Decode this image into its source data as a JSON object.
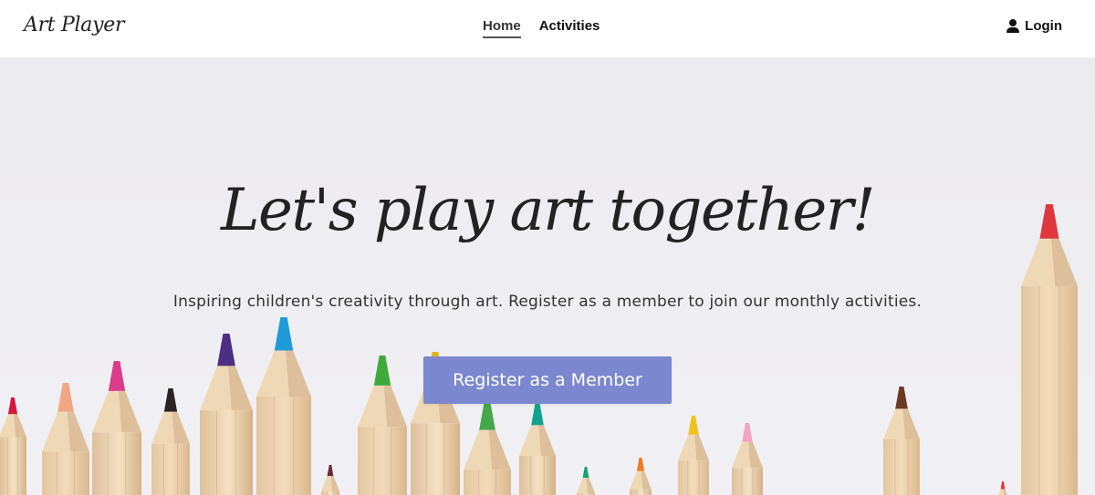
{
  "header": {
    "brand": "Art Player",
    "nav": [
      {
        "label": "Home",
        "active": true
      },
      {
        "label": "Activities",
        "active": false
      }
    ],
    "login_label": "Login",
    "login_icon": "user-icon"
  },
  "hero": {
    "title": "Let's play art together!",
    "subtitle": "Inspiring children's creativity through art. Register as a member to join our monthly activities.",
    "cta_label": "Register as a Member",
    "background_image": "colored-pencils"
  },
  "colors": {
    "cta": "#7b88d0",
    "hero_bg": "#eeedf1",
    "text": "#222222",
    "pencils": [
      "#d6163d",
      "#f1a783",
      "#dc3b8c",
      "#2b2424",
      "#4b2f83",
      "#1e9bd8",
      "#6a2a3a",
      "#3fa93b",
      "#e0b51c",
      "#45a84a",
      "#12a38f",
      "#16a36c",
      "#f07a25",
      "#f0c21d",
      "#f3a4c0",
      "#6a3a23",
      "#e5372f",
      "#e0373f"
    ]
  }
}
